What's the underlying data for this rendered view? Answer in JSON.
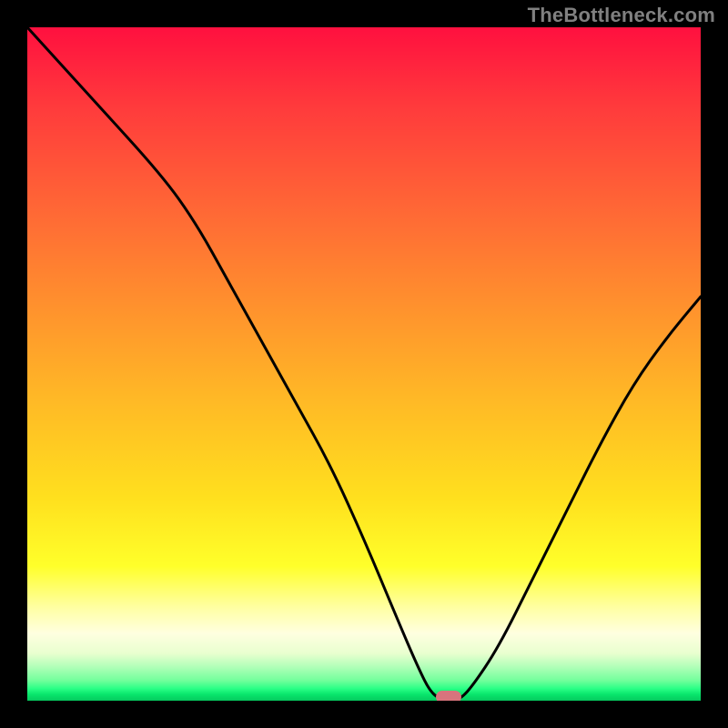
{
  "watermark": "TheBottleneck.com",
  "colors": {
    "marker": "#d8747d",
    "curve": "#000000",
    "frame": "#000000"
  },
  "chart_data": {
    "type": "line",
    "title": "",
    "xlabel": "",
    "ylabel": "",
    "xlim": [
      0,
      100
    ],
    "ylim": [
      0,
      100
    ],
    "grid": false,
    "legend": false,
    "series": [
      {
        "name": "bottleneck-curve",
        "x": [
          0,
          10,
          20,
          25,
          30,
          35,
          40,
          45,
          50,
          55,
          58,
          60,
          62,
          64,
          66,
          70,
          75,
          80,
          85,
          90,
          95,
          100
        ],
        "values": [
          100,
          89,
          78,
          71,
          62,
          53,
          44,
          35,
          24,
          12,
          5,
          1,
          0,
          0,
          2,
          8,
          18,
          28,
          38,
          47,
          54,
          60
        ]
      }
    ],
    "marker": {
      "x": 62.5,
      "y": 0
    },
    "gradient_stops": [
      {
        "pct": 0,
        "color": "#ff103f"
      },
      {
        "pct": 12,
        "color": "#ff3b3c"
      },
      {
        "pct": 28,
        "color": "#ff6a35"
      },
      {
        "pct": 40,
        "color": "#ff8d2e"
      },
      {
        "pct": 55,
        "color": "#ffb826"
      },
      {
        "pct": 70,
        "color": "#ffe01e"
      },
      {
        "pct": 80,
        "color": "#ffff2a"
      },
      {
        "pct": 86,
        "color": "#ffffa0"
      },
      {
        "pct": 90,
        "color": "#ffffe0"
      },
      {
        "pct": 93,
        "color": "#e8ffcf"
      },
      {
        "pct": 95,
        "color": "#b0ffb8"
      },
      {
        "pct": 97,
        "color": "#72ff9b"
      },
      {
        "pct": 98.2,
        "color": "#2aff86"
      },
      {
        "pct": 99.1,
        "color": "#08e56b"
      },
      {
        "pct": 100,
        "color": "#06c95e"
      }
    ]
  }
}
